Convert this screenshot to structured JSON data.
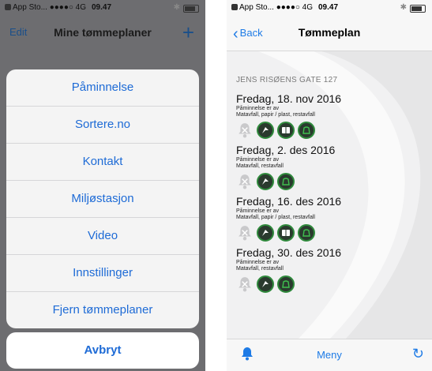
{
  "left": {
    "status": {
      "carrier": "App Sto... ●●●●○ 4G",
      "time": "09.47",
      "bluetooth": "✱"
    },
    "nav": {
      "edit": "Edit",
      "title": "Mine tømmeplaner",
      "add": "+"
    },
    "sheet_items": [
      "Påminnelse",
      "Sortere.no",
      "Kontakt",
      "Miljøstasjon",
      "Video",
      "Innstillinger",
      "Fjern tømmeplaner"
    ],
    "cancel": "Avbryt"
  },
  "right": {
    "status": {
      "carrier": "App Sto... ●●●●○ 4G",
      "time": "09.47",
      "bluetooth": "✱"
    },
    "nav": {
      "back": "Back",
      "title": "Tømmeplan"
    },
    "address": "JENS RISØENS GATE 127",
    "entries": [
      {
        "date": "Fredag, 18. nov 2016",
        "reminder": "Påminnelse er av",
        "types": "Matavfall, papir / plast, restavfall",
        "icons": [
          "bell-off",
          "plastic",
          "paper",
          "rest"
        ]
      },
      {
        "date": "Fredag, 2. des 2016",
        "reminder": "Påminnelse er av",
        "types": "Matavfall, restavfall",
        "icons": [
          "bell-off",
          "plastic",
          "rest"
        ]
      },
      {
        "date": "Fredag, 16. des 2016",
        "reminder": "Påminnelse er av",
        "types": "Matavfall, papir / plast, restavfall",
        "icons": [
          "bell-off",
          "plastic",
          "paper",
          "rest"
        ]
      },
      {
        "date": "Fredag, 30. des 2016",
        "reminder": "Påminnelse er av",
        "types": "Matavfall, restavfall",
        "icons": [
          "bell-off",
          "plastic",
          "rest"
        ]
      }
    ],
    "tabbar": {
      "menu": "Meny"
    }
  },
  "colors": {
    "accent": "#1e7be6",
    "bin_green": "#2f8a3c"
  }
}
